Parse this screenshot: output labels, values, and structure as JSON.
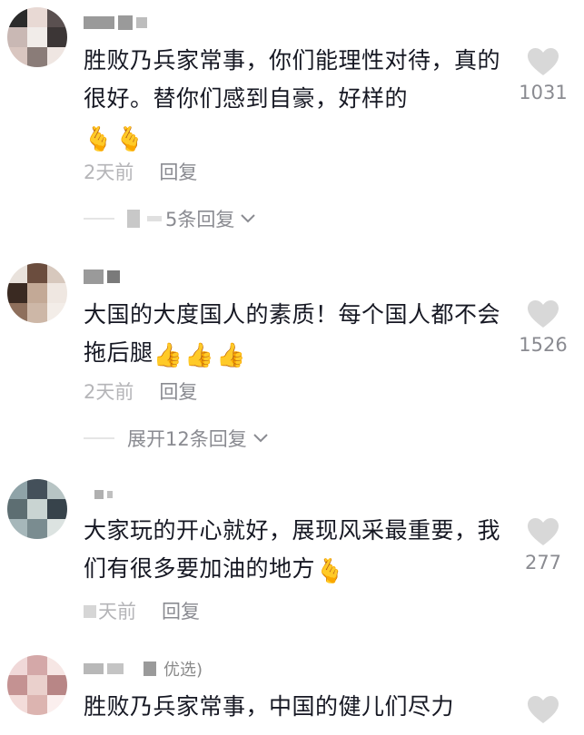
{
  "comments": [
    {
      "username": "",
      "text": "胜败乃兵家常事，你们能理性对待，真的很好。替你们感到自豪，好样的",
      "emojis": [
        "🫰",
        "🫰"
      ],
      "time": "2天前",
      "reply_label": "回复",
      "like_count": "1031",
      "expand_text": "5条回复",
      "avatar_colors": [
        "#2b2b2b",
        "#e8d9d4",
        "#5a5050",
        "#c9b8b4",
        "#f1ece9",
        "#3c3636",
        "#d9c6c0",
        "#8a7c78",
        "#efe6e2"
      ]
    },
    {
      "username": "",
      "text": "大国的大度国人的素质！每个国人都不会拖后腿",
      "emojis": [
        "👍",
        "👍",
        "👍"
      ],
      "time": "2天前",
      "reply_label": "回复",
      "like_count": "1526",
      "expand_text": "展开12条回复",
      "avatar_colors": [
        "#e9e2dc",
        "#6b4d3e",
        "#d7c8bd",
        "#3a2a22",
        "#c3a996",
        "#efe7e1",
        "#8e6f5c",
        "#cdb7a7",
        "#f3ede8"
      ]
    },
    {
      "username": "",
      "text": "大家玩的开心就好，展现风采最重要，我们有很多要加油的地方",
      "emojis": [
        "🫰"
      ],
      "time": "天前",
      "reply_label": "回复",
      "like_count": "277",
      "avatar_colors": [
        "#8fa3a8",
        "#44505a",
        "#b7c4c4",
        "#5d6e72",
        "#c9d4d2",
        "#37434b",
        "#a6b7ba",
        "#7a8c90",
        "#dce3e1"
      ]
    },
    {
      "username": "",
      "tag": "优选)",
      "text": "胜败乃兵家常事，中国的健儿们尽力",
      "avatar_colors": [
        "#f0d8d8",
        "#d4a8a8",
        "#f6e6e4",
        "#c49292",
        "#ead0cc",
        "#b88686",
        "#f3dcda",
        "#dcb4b0",
        "#fbefee"
      ]
    }
  ],
  "colors": {
    "text": "#161823",
    "meta": "#b5b5b8",
    "secondary": "#8a8b91",
    "heart": "#d8d8d8"
  },
  "icons": {
    "like": "heart-icon",
    "expand": "chevron-down-icon"
  }
}
